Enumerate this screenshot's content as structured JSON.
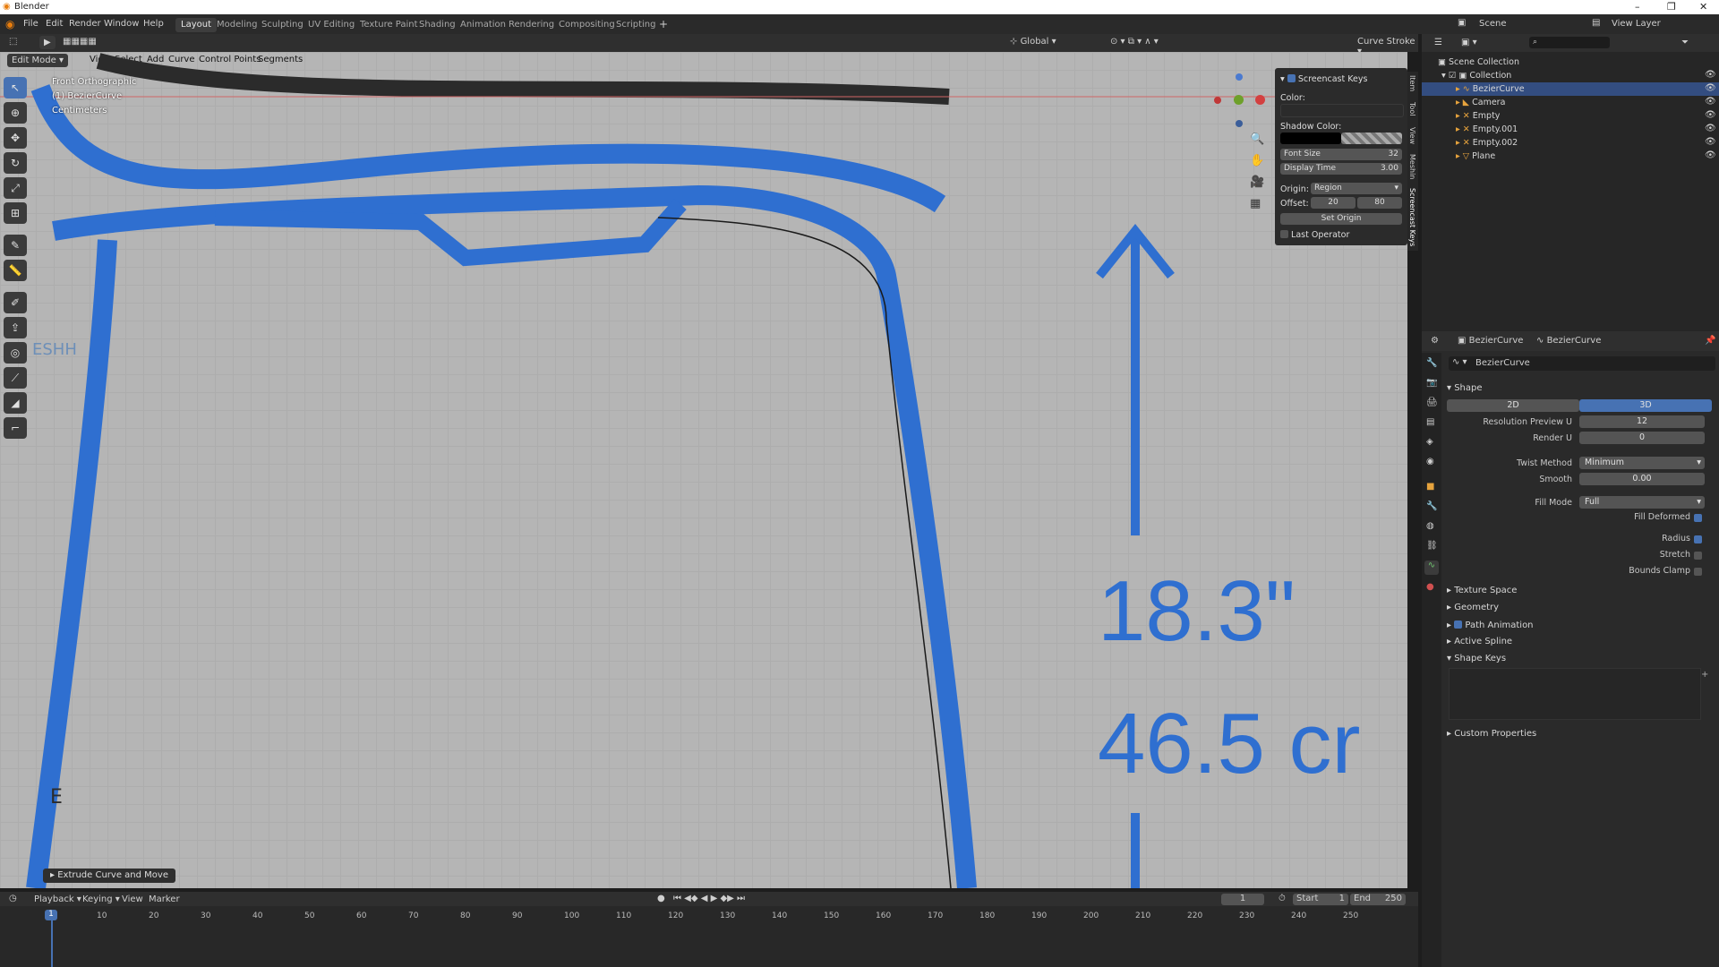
{
  "app": {
    "title": "Blender"
  },
  "menu": [
    "File",
    "Edit",
    "Render",
    "Window",
    "Help"
  ],
  "workspaces": [
    "Layout",
    "Modeling",
    "Sculpting",
    "UV Editing",
    "Texture Paint",
    "Shading",
    "Animation",
    "Rendering",
    "Compositing",
    "Scripting"
  ],
  "scene": {
    "label": "Scene",
    "view_layer": "View Layer"
  },
  "viewport_header": {
    "mode": "Edit Mode",
    "menus": [
      "View",
      "Select",
      "Add",
      "Curve",
      "Control Points",
      "Segments"
    ],
    "orientation": "Global",
    "tool": "Curve Stroke"
  },
  "viewport": {
    "view_name": "Front Orthographic",
    "object": "(1) BezierCurve",
    "units": "Centimeters",
    "key_overlay": "E",
    "operator": "Extrude Curve and Move",
    "logo": "ESHH",
    "dim_inches": "18.3\"",
    "dim_cm": "46.5 cr"
  },
  "screencast_panel": {
    "title": "Screencast Keys",
    "color_label": "Color:",
    "shadow_label": "Shadow Color:",
    "font_size_label": "Font Size",
    "font_size": "32",
    "display_time_label": "Display Time",
    "display_time": "3.00",
    "origin_label": "Origin:",
    "origin": "Region",
    "offset_label": "Offset:",
    "offset_x": "20",
    "offset_y": "80",
    "set_origin": "Set Origin",
    "last_operator": "Last Operator"
  },
  "sidebar_tabs": [
    "Item",
    "Tool",
    "View",
    "Meshin",
    "Screencast Keys"
  ],
  "outliner": {
    "root": "Scene Collection",
    "collection": "Collection",
    "items": [
      "BezierCurve",
      "Camera",
      "Empty",
      "Empty.001",
      "Empty.002",
      "Plane"
    ]
  },
  "properties": {
    "object_name": "BezierCurve",
    "data_name": "BezierCurve",
    "datablock": "BezierCurve",
    "shape_section": "Shape",
    "mode_2d": "2D",
    "mode_3d": "3D",
    "res_preview_label": "Resolution Preview U",
    "res_preview": "12",
    "render_u_label": "Render U",
    "render_u": "0",
    "twist_label": "Twist Method",
    "twist": "Minimum",
    "smooth_label": "Smooth",
    "smooth": "0.00",
    "fill_label": "Fill Mode",
    "fill": "Full",
    "fill_deformed": "Fill Deformed",
    "radius": "Radius",
    "stretch": "Stretch",
    "bounds_clamp": "Bounds Clamp",
    "sections": [
      "Texture Space",
      "Geometry",
      "Path Animation",
      "Active Spline",
      "Shape Keys"
    ],
    "custom_props": "Custom Properties"
  },
  "timeline": {
    "menus": [
      "Playback",
      "Keying",
      "View",
      "Marker"
    ],
    "current_frame": "1",
    "start_label": "Start",
    "start": "1",
    "end_label": "End",
    "end": "250",
    "ticks": [
      "1",
      "10",
      "20",
      "30",
      "40",
      "50",
      "60",
      "70",
      "80",
      "90",
      "100",
      "110",
      "120",
      "130",
      "140",
      "150",
      "160",
      "170",
      "180",
      "190",
      "200",
      "210",
      "220",
      "230",
      "240",
      "250"
    ]
  },
  "colors": {
    "accent": "#4772b3",
    "chair_stroke": "#2f6fd0",
    "viewport_bg": "#b5b5b5"
  }
}
